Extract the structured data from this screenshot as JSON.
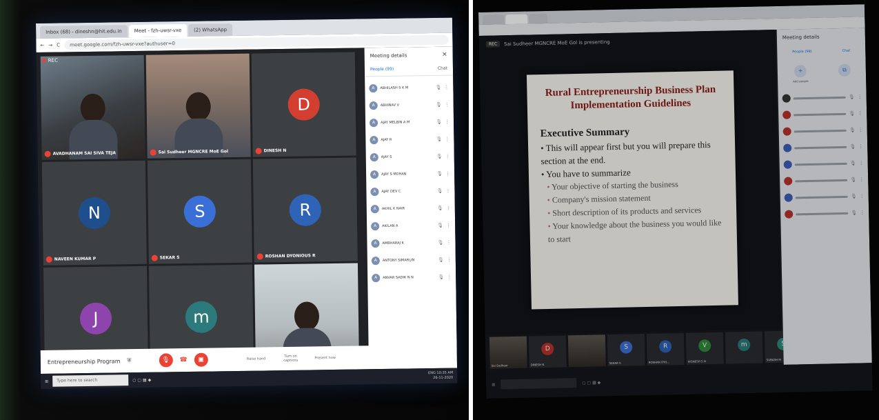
{
  "left": {
    "browser": {
      "tabs": [
        "Inbox (68) - dineshn@hit.edu.in",
        "Meet - fzh-uwsr-vxe",
        "(2) WhatsApp"
      ],
      "url": "meet.google.com/fzh-uwsr-vxe?authuser=0"
    },
    "rec_label": "REC",
    "tiles": [
      {
        "name": "AVADHANAM SAI SIVA TEJA",
        "kind": "camera"
      },
      {
        "name": "Sai Sudheer MGNCRE MoE Gol",
        "kind": "camera2"
      },
      {
        "name": "DINESH N",
        "kind": "avatar",
        "letter": "D",
        "color": "#d23f31"
      },
      {
        "name": "NAVEEN KUMAR P",
        "kind": "avatar",
        "letter": "N",
        "color": "#1f4e8c"
      },
      {
        "name": "SEKAR S",
        "kind": "avatar",
        "letter": "S",
        "color": "#3b6fd8"
      },
      {
        "name": "ROSHAN DYONIOUS R",
        "kind": "avatar",
        "letter": "R",
        "color": "#2e63b8"
      },
      {
        "name": "",
        "kind": "avatar",
        "letter": "J",
        "color": "#8e44ad"
      },
      {
        "name": "",
        "kind": "avatar",
        "letter": "m",
        "color": "#2c7a7b"
      },
      {
        "name": "",
        "kind": "camera3"
      }
    ],
    "panel": {
      "title": "Meeting details",
      "people_tab": "People (99)",
      "chat_tab": "Chat",
      "people": [
        "ABHILASH S K M",
        "ABHINAV V",
        "AJAY MELBIN A M",
        "AJAY R",
        "AJAY S",
        "AJAY S MOHAN",
        "AJAY DEV C",
        "AKHIL K NAIR",
        "AKILAN A",
        "AMBHARAJ K",
        "ANTONY SIMARLIN",
        "ANVAR SADIK N N"
      ]
    },
    "controls": {
      "program": "Entrepreneurship Program",
      "raise_hand": "Raise hand",
      "captions": "Turn on captions",
      "present": "Present now"
    },
    "taskbar": {
      "search": "Type here to search",
      "lang": "ENG",
      "time": "10:35 AM",
      "date": "26-11-2020"
    }
  },
  "right": {
    "presenting": "Sai Sudheer MGNCRE MoE Gol is presenting",
    "rec_label": "REC",
    "slide": {
      "title_line1": "Rural Entrepreneurship Business Plan",
      "title_line2": "Implementation Guidelines",
      "heading": "Executive Summary",
      "bullets": [
        {
          "text": "This will appear first but you will prepare this section at the end.",
          "level": 1
        },
        {
          "text": "You have to summarize",
          "level": 1
        },
        {
          "text": "Your objective of starting the business",
          "level": 2
        },
        {
          "text": "Company's mission statement",
          "level": 2
        },
        {
          "text": "Short description of its products and services",
          "level": 2
        },
        {
          "text": "Your knowledge about the business you would like to start",
          "level": 2
        }
      ]
    },
    "strip": [
      {
        "name": "Sai Sudheer",
        "kind": "camera"
      },
      {
        "name": "DINESH N",
        "letter": "D",
        "color": "#b8332a"
      },
      {
        "name": "",
        "kind": "camera"
      },
      {
        "name": "SEKAR S",
        "letter": "S",
        "color": "#3b6fd8"
      },
      {
        "name": "ROSHAN DYO...",
        "letter": "R",
        "color": "#2e63b8"
      },
      {
        "name": "VIGNESH S N",
        "letter": "V",
        "color": "#2f8a3a"
      },
      {
        "name": "",
        "letter": "m",
        "color": "#2c7a7b"
      },
      {
        "name": "SUBASH M",
        "letter": "S",
        "color": "#2c8a7a"
      }
    ],
    "panel": {
      "title": "Meeting details",
      "people_tab": "People (98)",
      "chat_tab": "Chat",
      "add_people": "Add people",
      "rows": [
        {
          "color": "#333"
        },
        {
          "color": "#b8332a"
        },
        {
          "color": "#b8332a"
        },
        {
          "color": "#3b5fb8"
        },
        {
          "color": "#3b5fb8"
        },
        {
          "color": "#b8332a"
        },
        {
          "color": "#3b5fb8"
        },
        {
          "color": "#b8332a"
        }
      ]
    }
  }
}
